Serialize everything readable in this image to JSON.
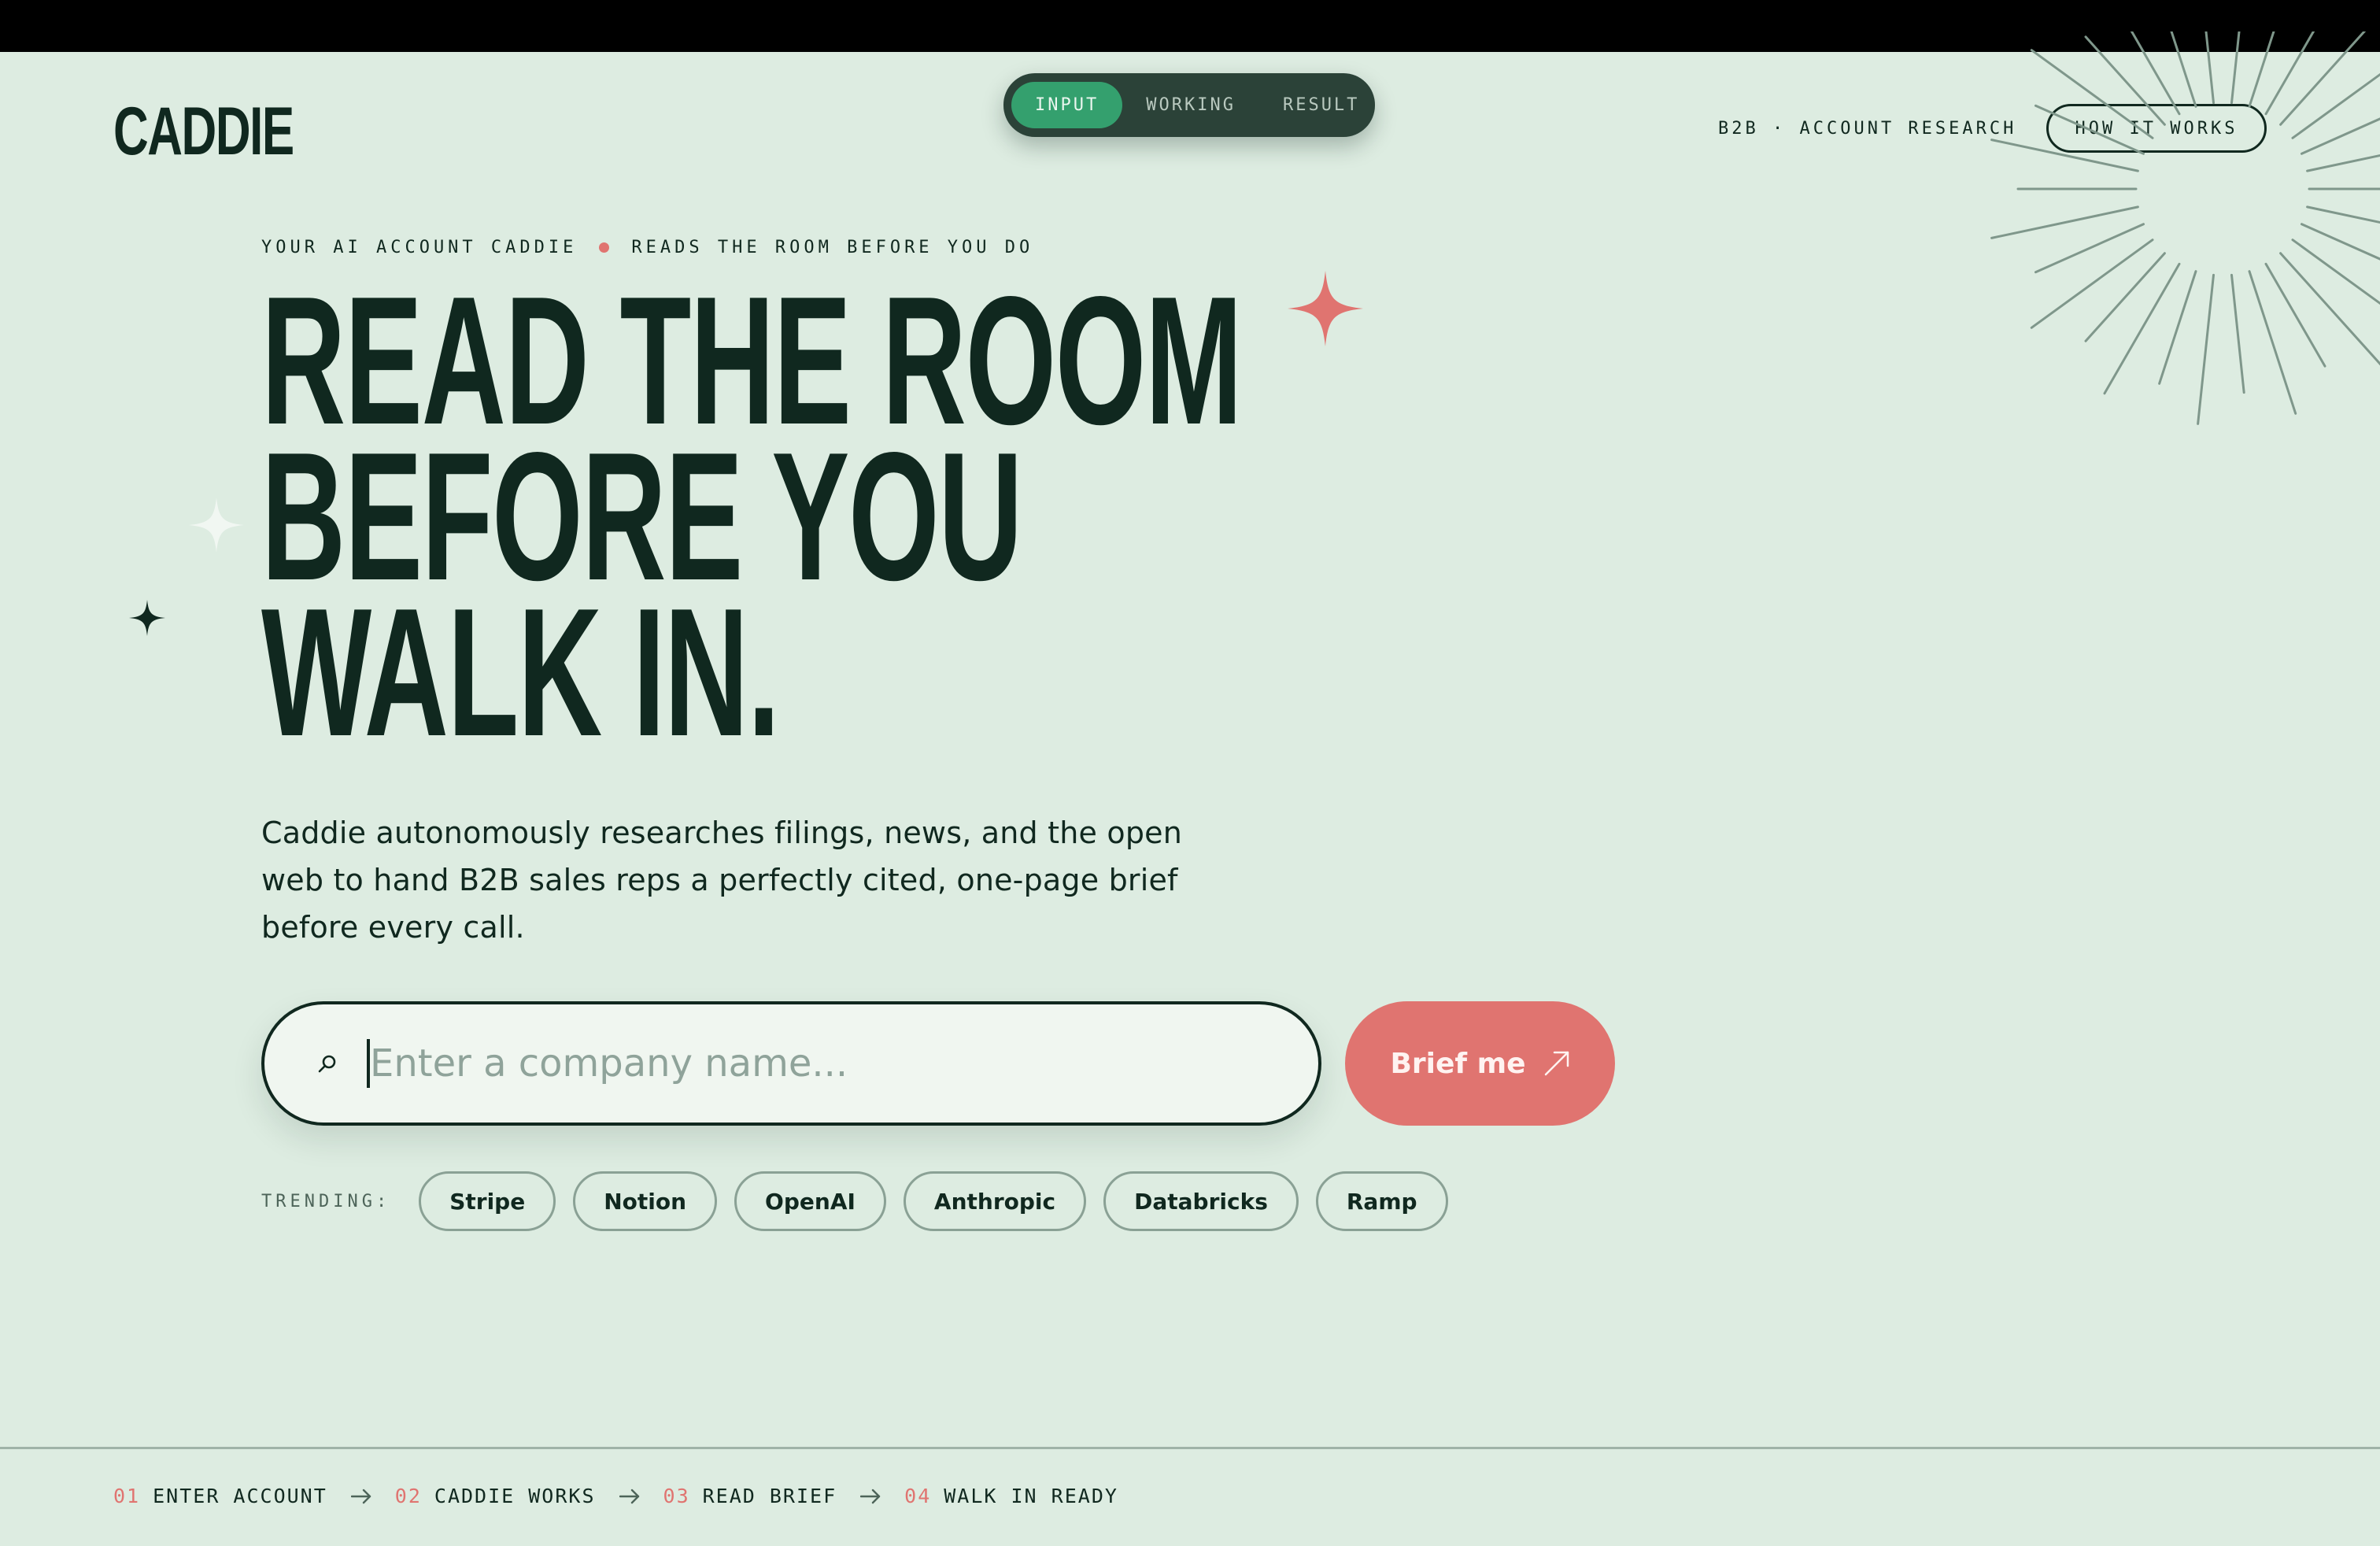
{
  "brand": {
    "logo": "CADDIE"
  },
  "mode_switch": {
    "tabs": [
      {
        "label": "INPUT",
        "active": true
      },
      {
        "label": "WORKING",
        "active": false
      },
      {
        "label": "RESULT",
        "active": false
      }
    ]
  },
  "nav": {
    "meta": "B2B · ACCOUNT RESEARCH",
    "how_it_works": "HOW IT WORKS"
  },
  "hero": {
    "eyebrow_left": "YOUR AI ACCOUNT CADDIE",
    "eyebrow_right": "READS THE ROOM BEFORE YOU DO",
    "headline_lines": [
      "READ THE ROOM",
      "BEFORE YOU",
      "WALK IN."
    ],
    "subcopy": "Caddie autonomously researches filings, news, and the open web to hand B2B sales reps a perfectly cited, one-page brief before every call."
  },
  "search": {
    "placeholder": "Enter a company name...",
    "value": "",
    "button_label": "Brief me"
  },
  "trending": {
    "label": "TRENDING:",
    "items": [
      "Stripe",
      "Notion",
      "OpenAI",
      "Anthropic",
      "Databricks",
      "Ramp"
    ]
  },
  "steps": [
    {
      "num": "01",
      "label": "ENTER ACCOUNT"
    },
    {
      "num": "02",
      "label": "CADDIE WORKS"
    },
    {
      "num": "03",
      "label": "READ BRIEF"
    },
    {
      "num": "04",
      "label": "WALK IN READY"
    }
  ],
  "colors": {
    "background": "#ddece1",
    "ink": "#10281f",
    "accent_coral": "#e07470",
    "accent_green": "#34a06e",
    "switch_bg": "#2b4238"
  }
}
